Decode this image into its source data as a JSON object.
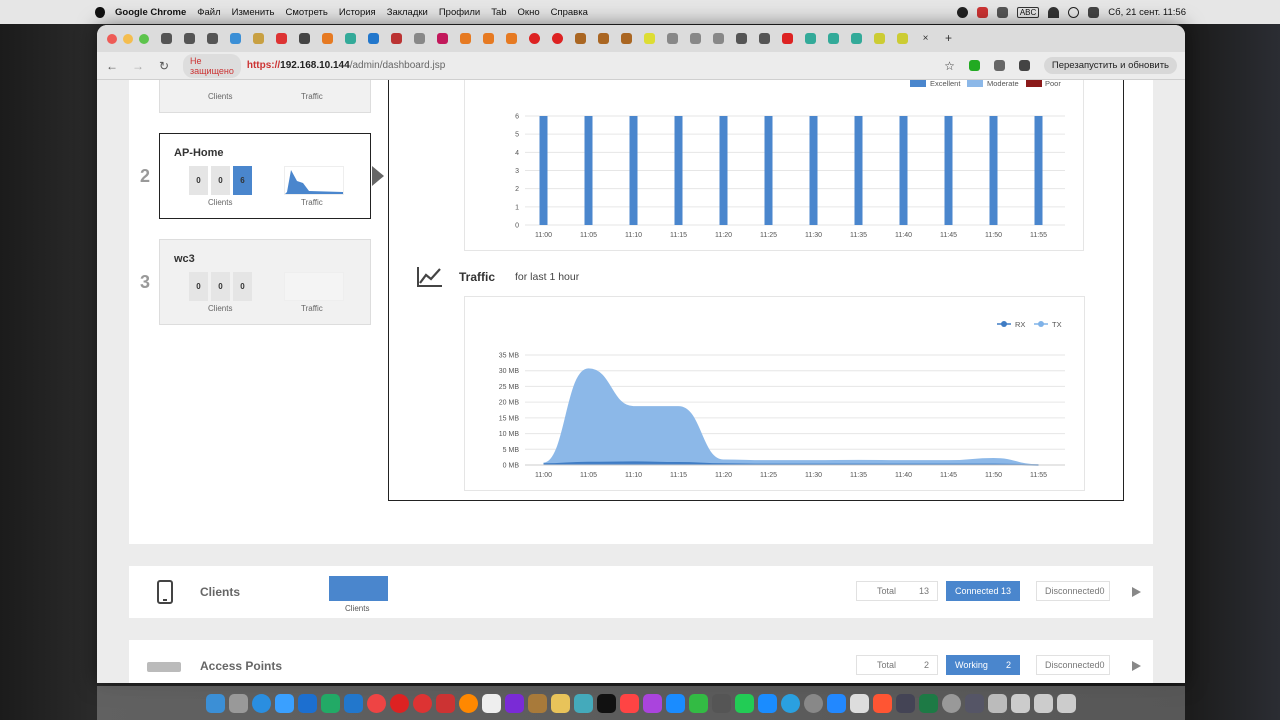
{
  "menubar": {
    "app": "Google Chrome",
    "items": [
      "Файл",
      "Изменить",
      "Смотреть",
      "История",
      "Закладки",
      "Профили",
      "Tab",
      "Окно",
      "Справка"
    ],
    "input_source": "ABC",
    "datetime": "Сб, 21 сент.  11:56"
  },
  "browser": {
    "security_label": "Не защищено",
    "url_scheme": "https://",
    "url_host": "192.168.10.144",
    "url_path": "/admin/dashboard.jsp",
    "restart_label": "Перезапустить и обновить"
  },
  "ap_list": [
    {
      "num": "",
      "name": "",
      "counts": [],
      "clients_label": "Clients",
      "traffic_label": "Traffic"
    },
    {
      "num": "2",
      "name": "AP-Home",
      "counts": [
        "0",
        "0",
        "6"
      ],
      "clients_label": "Clients",
      "traffic_label": "Traffic"
    },
    {
      "num": "3",
      "name": "wc3",
      "counts": [
        "0",
        "0",
        "0"
      ],
      "clients_label": "Clients",
      "traffic_label": "Traffic"
    }
  ],
  "quality_chart": {
    "legend": [
      "Excellent",
      "Moderate",
      "Poor"
    ],
    "colors": {
      "Excellent": "#4a86cd",
      "Moderate": "#8cb8e8",
      "Poor": "#8b1a1a"
    }
  },
  "traffic": {
    "title": "Traffic",
    "subtitle": "for last 1 hour",
    "legend": [
      "RX",
      "TX"
    ]
  },
  "chart_data": [
    {
      "type": "bar",
      "categories": [
        "11:00",
        "11:05",
        "11:10",
        "11:15",
        "11:20",
        "11:25",
        "11:30",
        "11:35",
        "11:40",
        "11:45",
        "11:50",
        "11:55"
      ],
      "series": [
        {
          "name": "Excellent",
          "values": [
            6,
            6,
            6,
            6,
            6,
            6,
            6,
            6,
            6,
            6,
            6,
            6
          ]
        },
        {
          "name": "Moderate",
          "values": [
            0,
            0,
            0,
            0,
            0,
            0,
            0,
            0,
            0,
            0,
            0,
            0
          ]
        },
        {
          "name": "Poor",
          "values": [
            0,
            0,
            0,
            0,
            0,
            0,
            0,
            0,
            0,
            0,
            0,
            0
          ]
        }
      ],
      "ylim": [
        0,
        6
      ],
      "yticks": [
        "0",
        "1",
        "2",
        "3",
        "4",
        "5",
        "6"
      ],
      "legend_position": "top-right",
      "grid": true
    },
    {
      "type": "area",
      "x": [
        "11:00",
        "11:05",
        "11:10",
        "11:15",
        "11:20",
        "11:25",
        "11:30",
        "11:35",
        "11:40",
        "11:45",
        "11:50",
        "11:55"
      ],
      "series": [
        {
          "name": "RX",
          "values": [
            0.3,
            0.8,
            0.9,
            0.7,
            0.3,
            0.2,
            0.2,
            0.2,
            0.2,
            0.2,
            0.2,
            0
          ]
        },
        {
          "name": "TX",
          "values": [
            0.5,
            30.5,
            18.5,
            18.5,
            1.5,
            1.3,
            1.3,
            1.4,
            1.3,
            1.3,
            2.0,
            0
          ]
        }
      ],
      "ylim": [
        0,
        35
      ],
      "yticks": [
        "0 MB",
        "5 MB",
        "10 MB",
        "15 MB",
        "20 MB",
        "25 MB",
        "30 MB",
        "35 MB"
      ],
      "ylabel": "",
      "legend_position": "top-right",
      "grid": true
    }
  ],
  "clients_section": {
    "title": "Clients",
    "chart_label": "Clients",
    "total_label": "Total",
    "total": "13",
    "connected_label": "Connected",
    "connected": "13",
    "disconnected_label": "Disconnected",
    "disconnected": "0"
  },
  "ap_section": {
    "title": "Access Points",
    "total_label": "Total",
    "total": "2",
    "working_label": "Working",
    "working": "2",
    "disconnected_label": "Disconnected",
    "disconnected": "0"
  }
}
